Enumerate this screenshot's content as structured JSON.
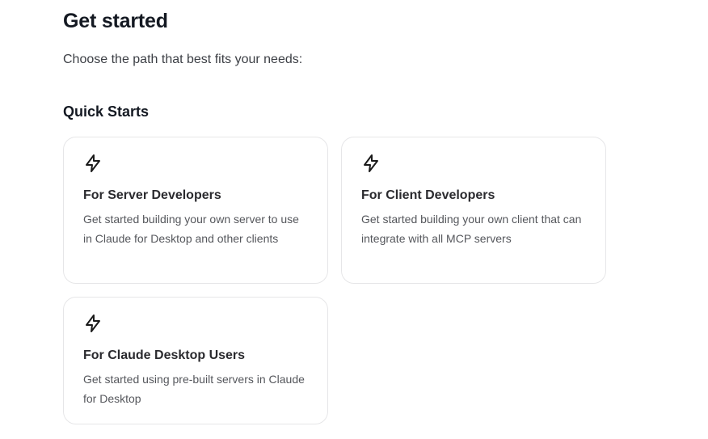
{
  "page": {
    "title": "Get started",
    "intro": "Choose the path that best fits your needs:"
  },
  "quick_starts": {
    "heading": "Quick Starts",
    "cards": [
      {
        "icon": "lightning-icon",
        "title": "For Server Developers",
        "description": "Get started building your own server to use in Claude for Desktop and other clients"
      },
      {
        "icon": "lightning-icon",
        "title": "For Client Developers",
        "description": "Get started building your own client that can integrate with all MCP servers"
      },
      {
        "icon": "lightning-icon",
        "title": "For Claude Desktop Users",
        "description": "Get started using pre-built servers in Claude for Desktop"
      }
    ]
  },
  "colors": {
    "heading": "#141922",
    "body_text": "#55575c",
    "card_border": "#e6e6e8"
  }
}
